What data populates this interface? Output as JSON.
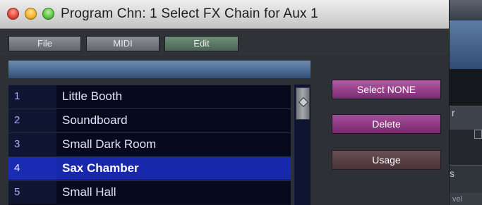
{
  "window": {
    "title": "Program Chn: 1  Select FX Chain for Aux 1"
  },
  "menu": {
    "file": "File",
    "midi": "MIDI",
    "edit": "Edit"
  },
  "list": {
    "rows": [
      {
        "num": "1",
        "name": "Little Booth",
        "selected": false
      },
      {
        "num": "2",
        "name": "Soundboard",
        "selected": false
      },
      {
        "num": "3",
        "name": "Small Dark Room",
        "selected": false
      },
      {
        "num": "4",
        "name": "Sax Chamber",
        "selected": true
      },
      {
        "num": "5",
        "name": "Small Hall",
        "selected": false
      }
    ]
  },
  "buttons": {
    "select_none": "Select NONE",
    "delete": "Delete",
    "usage": "Usage"
  },
  "background_app": {
    "char1": "r",
    "char2": "s",
    "char3": "vel"
  },
  "colors": {
    "selected_row": "#1828ad",
    "edit_tab": "#5f7c68",
    "action_button": "#9a4a8f"
  }
}
